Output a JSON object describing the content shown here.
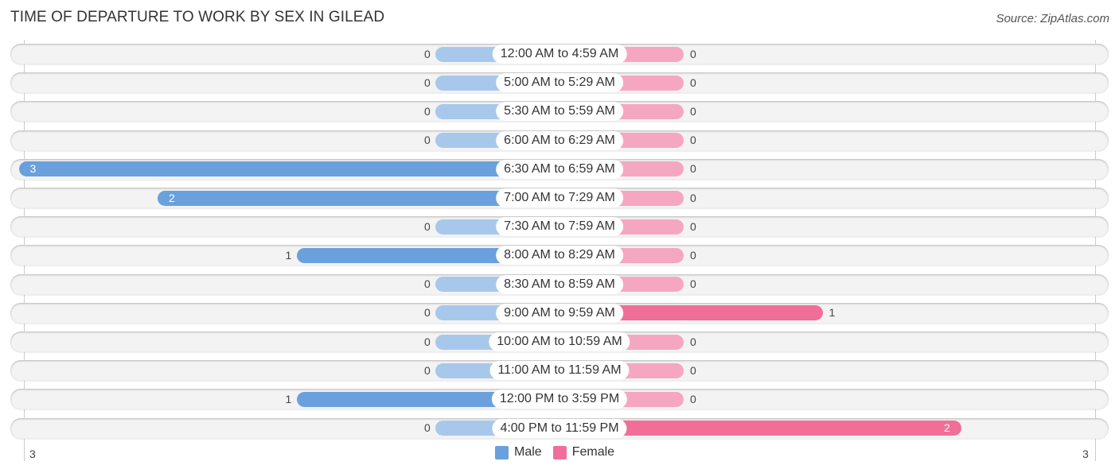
{
  "chart_data": {
    "type": "bar",
    "orientation": "horizontal-butterfly",
    "title": "TIME OF DEPARTURE TO WORK BY SEX IN GILEAD",
    "source": "Source: ZipAtlas.com",
    "categories": [
      "12:00 AM to 4:59 AM",
      "5:00 AM to 5:29 AM",
      "5:30 AM to 5:59 AM",
      "6:00 AM to 6:29 AM",
      "6:30 AM to 6:59 AM",
      "7:00 AM to 7:29 AM",
      "7:30 AM to 7:59 AM",
      "8:00 AM to 8:29 AM",
      "8:30 AM to 8:59 AM",
      "9:00 AM to 9:59 AM",
      "10:00 AM to 10:59 AM",
      "11:00 AM to 11:59 AM",
      "12:00 PM to 3:59 PM",
      "4:00 PM to 11:59 PM"
    ],
    "series": [
      {
        "name": "Male",
        "color": "#6aa0dc",
        "light_color": "#a8c8eb",
        "values": [
          0,
          0,
          0,
          0,
          3,
          2,
          0,
          1,
          0,
          0,
          0,
          0,
          1,
          0
        ]
      },
      {
        "name": "Female",
        "color": "#f06e98",
        "light_color": "#f5a7c1",
        "values": [
          0,
          0,
          0,
          0,
          0,
          0,
          0,
          0,
          0,
          1,
          0,
          0,
          0,
          2
        ]
      }
    ],
    "xlim": [
      -3,
      3
    ],
    "axis_tick_labels": {
      "left": "3",
      "right": "3"
    },
    "legend_position": "bottom-center"
  }
}
